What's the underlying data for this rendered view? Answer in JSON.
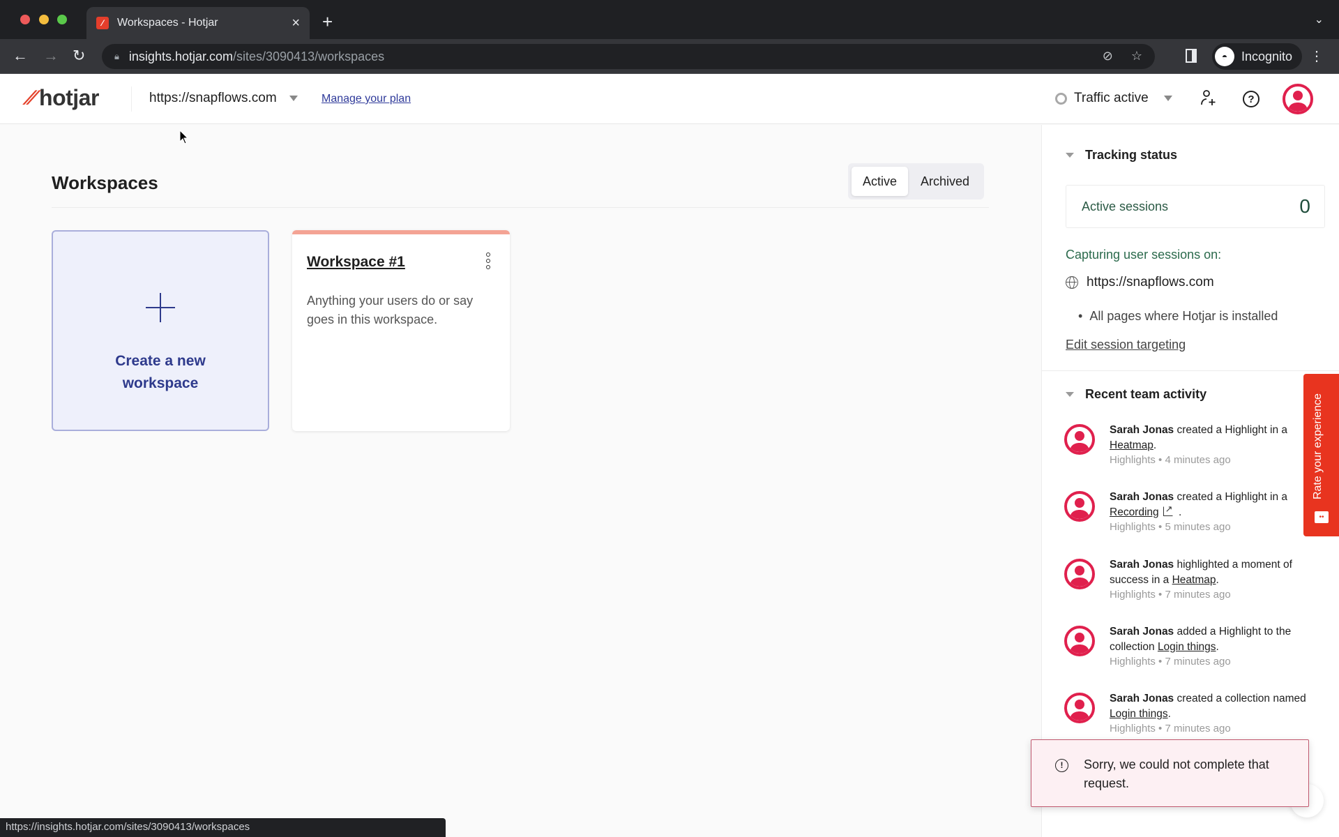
{
  "browser": {
    "tab_title": "Workspaces - Hotjar",
    "url_host": "insights.hotjar.com",
    "url_path": "/sites/3090413/workspaces",
    "profile_label": "Incognito",
    "status_url": "https://insights.hotjar.com/sites/3090413/workspaces"
  },
  "header": {
    "logo_text": "hotjar",
    "site_selector": "https://snapflows.com",
    "manage_plan": "Manage your plan",
    "traffic_status": "Traffic active"
  },
  "main": {
    "title": "Workspaces",
    "tabs": [
      {
        "label": "Active",
        "selected": true
      },
      {
        "label": "Archived",
        "selected": false
      }
    ],
    "create_card_label": "Create a new workspace",
    "workspaces": [
      {
        "title": "Workspace #1",
        "description": "Anything your users do or say goes in this workspace."
      }
    ]
  },
  "sidebar": {
    "tracking": {
      "heading": "Tracking status",
      "active_sessions_label": "Active sessions",
      "active_sessions_count": "0",
      "capturing_label": "Capturing user sessions on:",
      "site": "https://snapflows.com",
      "pages": "All pages where Hotjar is installed",
      "edit_link": "Edit session targeting"
    },
    "activity": {
      "heading": "Recent team activity",
      "items": [
        {
          "user": "Sarah Jonas",
          "action": " created a Highlight in a ",
          "link": "Heatmap",
          "after": ".",
          "external": false,
          "meta": "Highlights • 4 minutes ago"
        },
        {
          "user": "Sarah Jonas",
          "action": " created a Highlight in a ",
          "link": "Recording",
          "after": ".",
          "external": true,
          "meta": "Highlights • 5 minutes ago"
        },
        {
          "user": "Sarah Jonas",
          "action": " highlighted a moment of success in a ",
          "link": "Heatmap",
          "after": ".",
          "external": false,
          "meta": "Highlights • 7 minutes ago"
        },
        {
          "user": "Sarah Jonas",
          "action": " added a Highlight to the collection ",
          "link": "Login things",
          "after": ".",
          "external": false,
          "meta": "Highlights • 7 minutes ago"
        },
        {
          "user": "Sarah Jonas",
          "action": " created a collection named ",
          "link": "Login things",
          "after": ".",
          "external": false,
          "meta": "Highlights • 7 minutes ago"
        }
      ]
    }
  },
  "feedback_tab": "Rate your experience",
  "toast": {
    "message": "Sorry, we could not complete that request."
  },
  "colors": {
    "brand": "#e4422b",
    "accent_blue": "#2e3a8c",
    "avatar_red": "#e0204d",
    "feedback_red": "#e8341f",
    "workspace_accent": "#f4a394"
  }
}
